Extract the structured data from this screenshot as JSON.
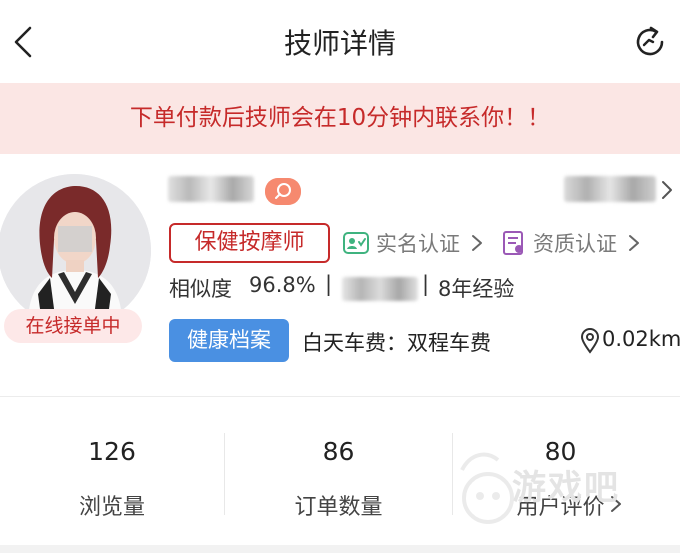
{
  "header": {
    "title": "技师详情"
  },
  "notice": {
    "text": "下单付款后技师会在10分钟内联系你！！"
  },
  "profile": {
    "status_badge": "在线接单中",
    "role_tag": "保健按摩师",
    "cert_real_name": "实名认证",
    "cert_qualification": "资质认证",
    "similarity_label": "相似度",
    "similarity_value": "96.8%",
    "separator": "|",
    "experience": "8年经验",
    "health_button": "健康档案",
    "fee_text": "白天车费：双程车费",
    "distance": "0.02km"
  },
  "stats": [
    {
      "value": "126",
      "label": "浏览量"
    },
    {
      "value": "86",
      "label": "订单数量"
    },
    {
      "value": "80",
      "label": "用户评价"
    }
  ],
  "watermark": {
    "text": "游戏吧"
  },
  "colors": {
    "accent_red": "#c62a2a",
    "notice_bg": "#fbe6e4",
    "health_blue": "#4a90e2"
  },
  "icons": {
    "back": "chevron-left-icon",
    "refresh": "refresh-icon",
    "tag": "search-tag-icon",
    "real_name": "id-card-icon",
    "qualification": "certificate-icon",
    "location": "location-pin-icon"
  }
}
